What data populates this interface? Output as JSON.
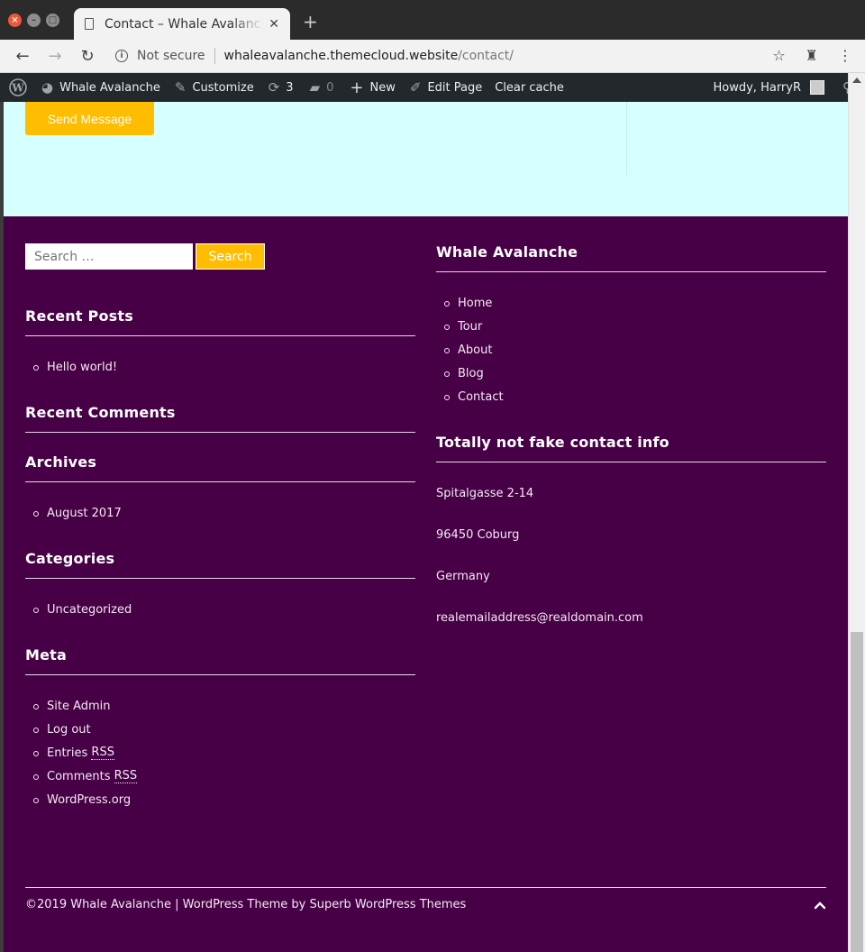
{
  "browser": {
    "tab_title": "Contact – Whale Avalanche",
    "not_secure": "Not secure",
    "url_host": "whaleavalanche.themecloud.website",
    "url_path": "/contact/"
  },
  "adminbar": {
    "site_name": "Whale Avalanche",
    "customize": "Customize",
    "updates_count": "3",
    "comments_count": "0",
    "new": "New",
    "edit_page": "Edit Page",
    "clear_cache": "Clear cache",
    "howdy": "Howdy, HarryR"
  },
  "contact_form": {
    "send_button": "Send Message"
  },
  "footer": {
    "search": {
      "placeholder": "Search …",
      "button": "Search"
    },
    "recent_posts": {
      "title": "Recent Posts",
      "items": [
        "Hello world!"
      ]
    },
    "recent_comments": {
      "title": "Recent Comments"
    },
    "archives": {
      "title": "Archives",
      "items": [
        "August 2017"
      ]
    },
    "categories": {
      "title": "Categories",
      "items": [
        "Uncategorized"
      ]
    },
    "meta": {
      "title": "Meta",
      "site_admin": "Site Admin",
      "log_out": "Log out",
      "entries_prefix": "Entries ",
      "comments_prefix": "Comments ",
      "rss": "RSS",
      "wordpress_org": "WordPress.org"
    },
    "menu": {
      "title": "Whale Avalanche",
      "items": [
        "Home",
        "Tour",
        "About",
        "Blog",
        "Contact"
      ]
    },
    "contact_info": {
      "title": "Totally not fake contact info",
      "street": "Spitalgasse 2-14",
      "city": "96450 Coburg",
      "country": "Germany",
      "email": "realemailaddress@realdomain.com"
    },
    "copyright": "©2019 Whale Avalanche | WordPress Theme by Superb WordPress Themes"
  },
  "colors": {
    "footer_bg": "#470045",
    "contact_bg": "#d6ffff",
    "accent": "#ffbd00",
    "adminbar_bg": "#23282d"
  }
}
